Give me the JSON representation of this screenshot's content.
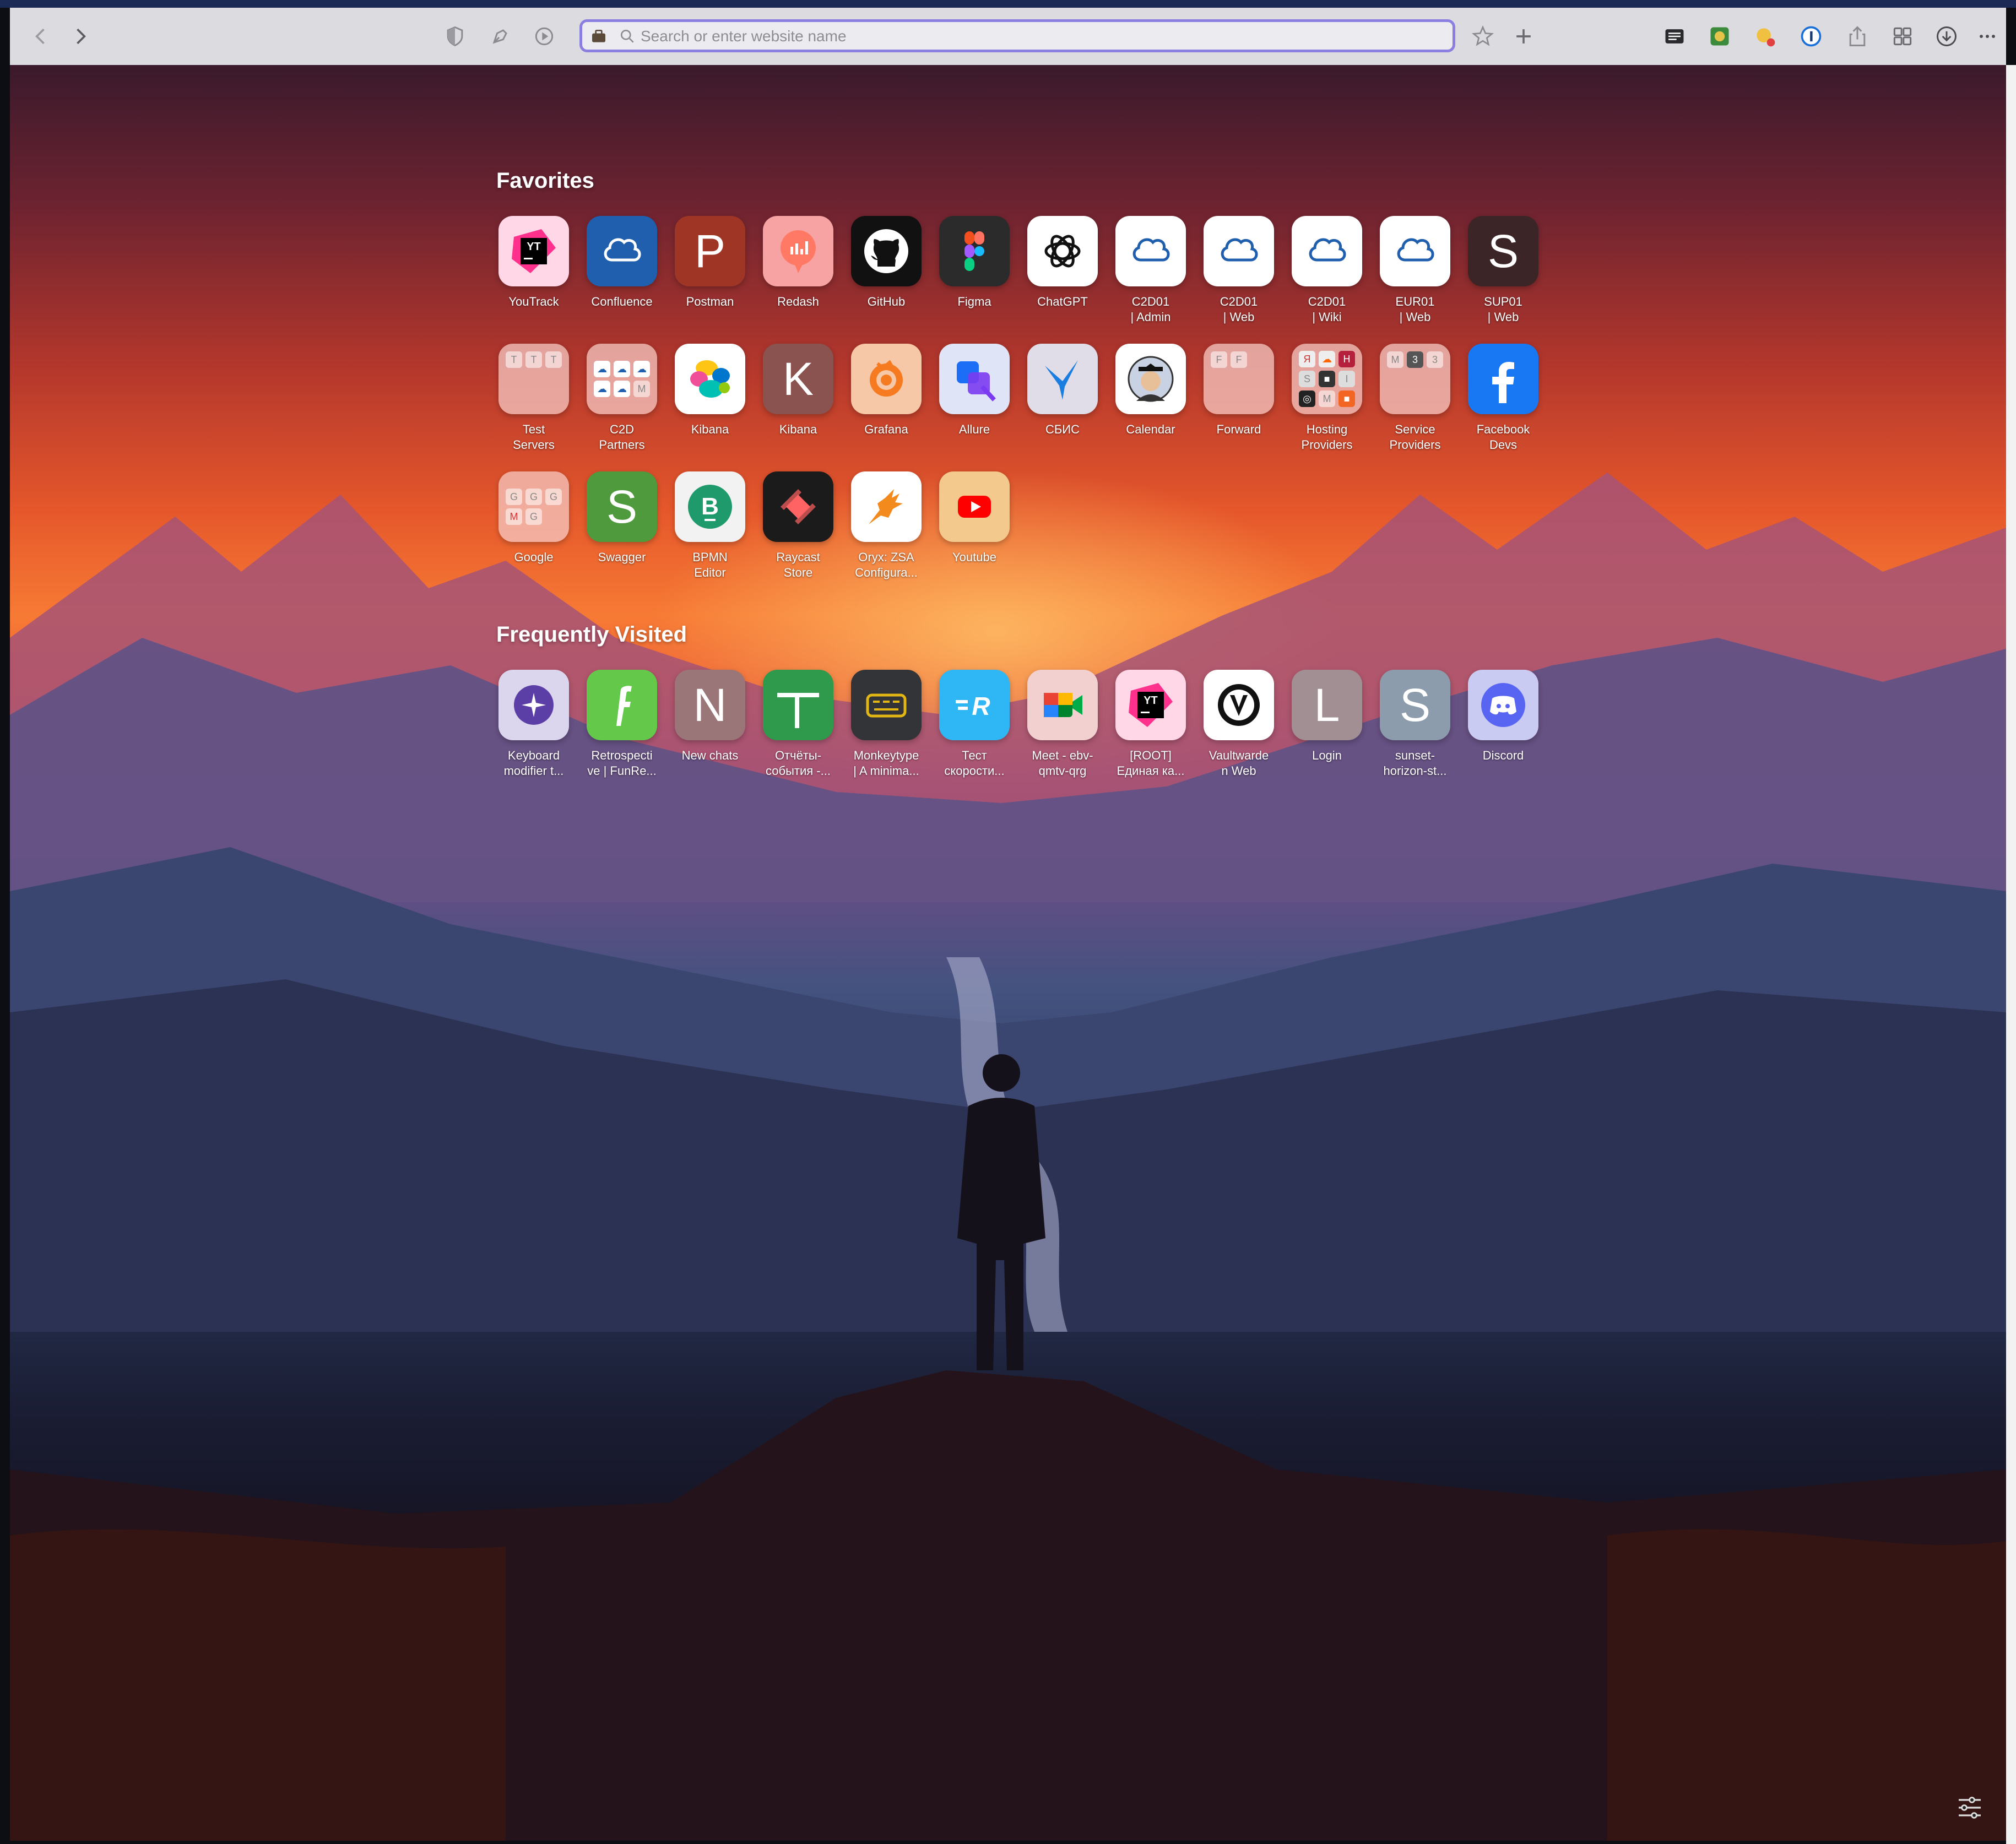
{
  "toolbar": {
    "search_placeholder": "Search or enter website name"
  },
  "favorites": {
    "title": "Favorites",
    "items": [
      {
        "label": "YouTrack"
      },
      {
        "label": "Confluence"
      },
      {
        "label": "Postman",
        "letter": "P"
      },
      {
        "label": "Redash"
      },
      {
        "label": "GitHub"
      },
      {
        "label": "Figma"
      },
      {
        "label": "ChatGPT"
      },
      {
        "label": "C2D01\n| Admin"
      },
      {
        "label": "C2D01\n| Web"
      },
      {
        "label": "C2D01\n| Wiki"
      },
      {
        "label": "EUR01\n| Web"
      },
      {
        "label": "SUP01\n| Web",
        "letter": "S"
      },
      {
        "label": "Test\nServers"
      },
      {
        "label": "C2D\nPartners"
      },
      {
        "label": "Kibana"
      },
      {
        "label": "Kibana",
        "letter": "K"
      },
      {
        "label": "Grafana"
      },
      {
        "label": "Allure"
      },
      {
        "label": "СБИС"
      },
      {
        "label": "Calendar"
      },
      {
        "label": "Forward"
      },
      {
        "label": "Hosting\nProviders"
      },
      {
        "label": "Service\nProviders"
      },
      {
        "label": "Facebook\nDevs"
      },
      {
        "label": "Google"
      },
      {
        "label": "Swagger",
        "letter": "S"
      },
      {
        "label": "BPMN\nEditor"
      },
      {
        "label": "Raycast\nStore"
      },
      {
        "label": "Oryx: ZSA\nConfigura..."
      },
      {
        "label": "Youtube"
      }
    ]
  },
  "frequently_visited": {
    "title": "Frequently Visited",
    "items": [
      {
        "label": "Keyboard\nmodifier t..."
      },
      {
        "label": "Retrospecti\nve | FunRe..."
      },
      {
        "label": "New chats",
        "letter": "N"
      },
      {
        "label": "Отчёты-\nсобытия -..."
      },
      {
        "label": "Monkeytype\n| A minima..."
      },
      {
        "label": "Тест\nскорости..."
      },
      {
        "label": "Meet - ebv-\nqmtv-qrg"
      },
      {
        "label": "[ROOT]\nЕдиная ка..."
      },
      {
        "label": "Vaultwarde\nn Web"
      },
      {
        "label": "Login",
        "letter": "L"
      },
      {
        "label": "sunset-\nhorizon-st...",
        "letter": "S"
      },
      {
        "label": "Discord"
      }
    ]
  },
  "colors": {
    "accent": "#8a7fe0",
    "toolbar_bg": "#dcdce0"
  }
}
